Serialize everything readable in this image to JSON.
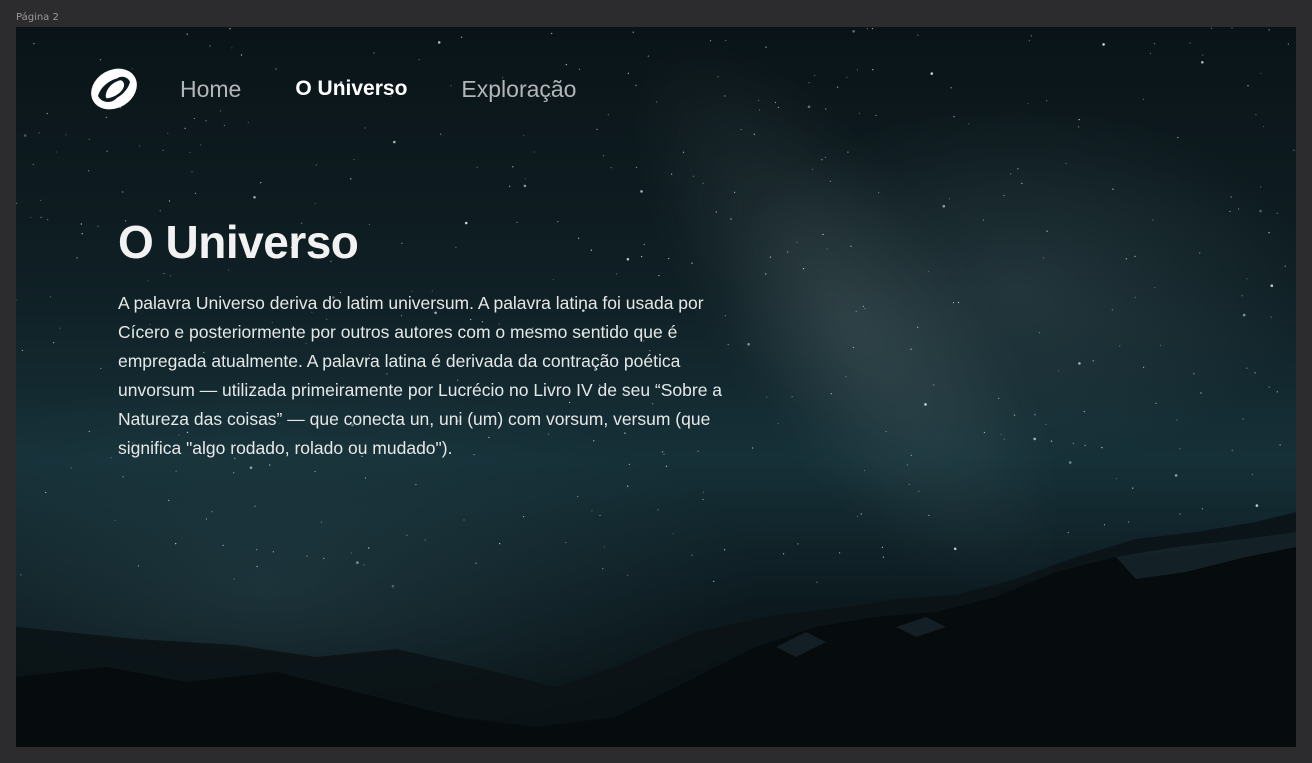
{
  "canvas": {
    "page_label": "Página 2"
  },
  "nav": {
    "logo_icon": "spiral-galaxy-logo-icon",
    "links": [
      {
        "label": "Home",
        "active": false
      },
      {
        "label": "O Universo",
        "active": true
      },
      {
        "label": "Exploração",
        "active": false
      }
    ]
  },
  "hero": {
    "title": "O Universo",
    "body": "A palavra Universo deriva do latim universum. A palavra latina foi usada por Cícero e posteriormente por outros autores com o mesmo sentido que é empregada atualmente. A palavra latina é derivada da contração poética unvorsum — utilizada primeiramente por Lucrécio no Livro IV de seu “Sobre a Natureza das coisas” — que conecta un, uni (um) com vorsum, versum (que significa \"algo rodado, rolado ou mudado\")."
  },
  "colors": {
    "canvas_bg": "#2c2c2e",
    "sky_top": "#0a1418",
    "sky_mid": "#163038",
    "active_link": "#ffffff",
    "inactive_link": "#b3b6b8"
  }
}
